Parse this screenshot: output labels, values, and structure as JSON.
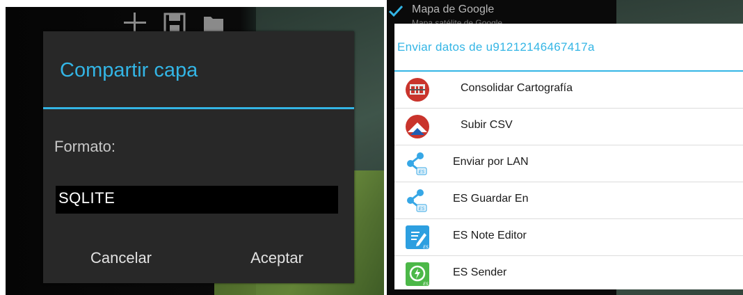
{
  "left": {
    "dialog": {
      "title": "Compartir capa",
      "format_label": "Formato:",
      "format_value": "SQLITE",
      "cancel_label": "Cancelar",
      "accept_label": "Aceptar"
    },
    "toolbar_icons": [
      "plus-icon",
      "save-icon",
      "folder-icon"
    ]
  },
  "right": {
    "background_item": {
      "label": "Mapa de Google",
      "sublabel": "Mapa satélite de Google"
    },
    "share_sheet": {
      "title": "Enviar datos de u91212146467417a",
      "apps": [
        {
          "label": "Consolidar Cartografía",
          "icon": "consolidar-cartografia-icon"
        },
        {
          "label": "Subir CSV",
          "icon": "subir-csv-icon"
        },
        {
          "label": "Enviar por LAN",
          "icon": "es-share-icon"
        },
        {
          "label": "ES Guardar En",
          "icon": "es-share-icon"
        },
        {
          "label": "ES Note Editor",
          "icon": "es-note-editor-icon"
        },
        {
          "label": "ES Sender",
          "icon": "es-sender-icon"
        }
      ]
    }
  },
  "colors": {
    "accent": "#33b5e5",
    "dialog_bg": "#282828",
    "sheet_bg": "#ffffff"
  }
}
